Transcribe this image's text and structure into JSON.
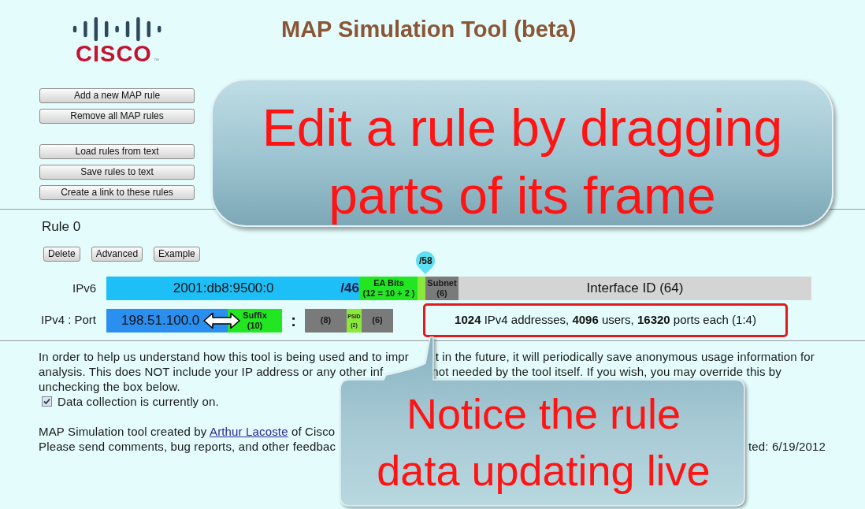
{
  "header": {
    "logo": {
      "wordmark": "CISCO",
      "trademark": "™"
    },
    "title": "MAP Simulation Tool (beta)"
  },
  "toolbar": {
    "groups": [
      [
        "Add a new MAP rule",
        "Remove all MAP rules"
      ],
      [
        "Load rules from text",
        "Save rules to text",
        "Create a link to these rules"
      ]
    ]
  },
  "rule": {
    "title": "Rule 0",
    "buttons": [
      "Delete",
      "Advanced",
      "Example"
    ],
    "ipv6": {
      "label": "IPv6",
      "marker": "/58",
      "segments": [
        {
          "kind": "prefix",
          "value": "2001:db8:9500:0",
          "length": "/46"
        },
        {
          "kind": "ea_bits",
          "lines": [
            "EA Bits",
            "(12 = 10 + 2 )"
          ]
        },
        {
          "kind": "ea_extension"
        },
        {
          "kind": "subnet",
          "lines": [
            "Subnet",
            "(6)"
          ]
        },
        {
          "kind": "interface_id",
          "lines": [
            "Interface ID (64)"
          ]
        }
      ]
    },
    "ipv4": {
      "label": "IPv4 : Port",
      "segments": [
        {
          "kind": "address",
          "lines": [
            "198.51.100.0"
          ]
        },
        {
          "kind": "suffix",
          "lines": [
            "Suffix",
            "(10)"
          ]
        },
        {
          "kind": "separator",
          "lines": [
            ":"
          ]
        },
        {
          "kind": "port_bits",
          "lines": [
            "(8)"
          ]
        },
        {
          "kind": "psid",
          "lines": [
            "PSID",
            "(2)"
          ]
        },
        {
          "kind": "port_bits",
          "lines": [
            "(6)"
          ]
        }
      ]
    },
    "summary": "**1024** IPv4 addresses, **4096** users, **16320** ports each (1:4)"
  },
  "notice": {
    "lines": [
      [
        "In order to help us understand how this tool is being used and to impr",
        "t in the future, it will periodically save anonymous usage information for"
      ],
      [
        "analysis. This does NOT include your IP address or any other inf",
        "not needed by the tool itself. If you wish, you may override this by"
      ],
      [
        "unchecking the box below."
      ]
    ],
    "checkbox": {
      "label": "Data collection is currently on.",
      "checked": true
    }
  },
  "footer": {
    "credit": {
      "before": "MAP Simulation tool created by ",
      "link": "Arthur Lacoste",
      "after": " of Cisco"
    },
    "feedback": [
      "Please send comments, bug reports, and other feedbac",
      "ted: 6/19/2012"
    ]
  },
  "callouts": [
    {
      "kind": "banner",
      "lines": [
        "Edit a rule by dragging",
        "parts of its frame"
      ]
    },
    {
      "kind": "speech_bubble",
      "lines": [
        "Notice the rule",
        "data updating live"
      ]
    }
  ]
}
